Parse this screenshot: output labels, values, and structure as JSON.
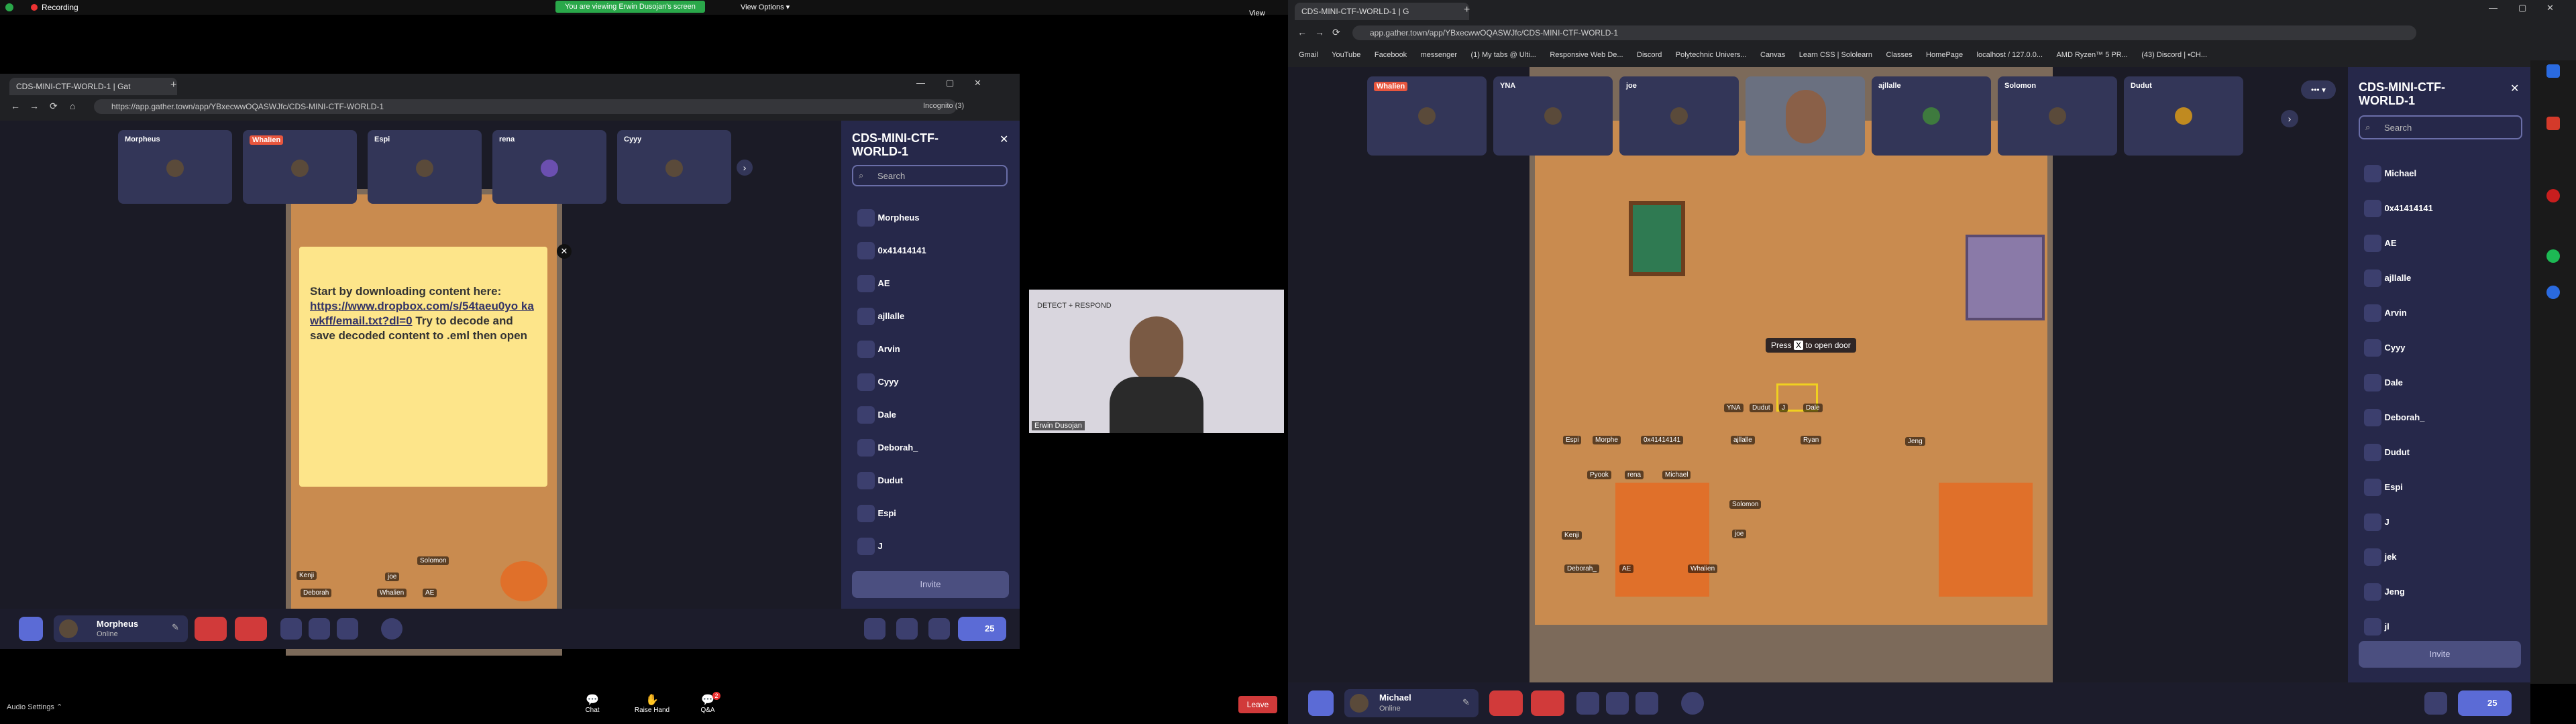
{
  "zoom": {
    "recording_label": "Recording",
    "viewing_banner": "You are viewing Erwin Dusojan's screen",
    "view_options": "View Options ▾",
    "view_label": "View",
    "audio_settings": "Audio Settings ⌃",
    "chat_label": "Chat",
    "raise_hand_label": "Raise Hand",
    "qa_label": "Q&A",
    "qa_badge": "2",
    "leave_label": "Leave",
    "webcam_overlay": "DETECT + RESPOND",
    "webcam_name": "Erwin Dusojan"
  },
  "left_browser": {
    "tab_title": "CDS-MINI-CTF-WORLD-1 | Gat",
    "url": "https://app.gather.town/app/YBxecwwOQASWJfc/CDS-MINI-CTF-WORLD-1",
    "incognito": "Incognito (3)",
    "participants": [
      {
        "name": "Morpheus"
      },
      {
        "name": "Whalien"
      },
      {
        "name": "Espi"
      },
      {
        "name": "rena"
      },
      {
        "name": "Cyyy"
      }
    ],
    "note_text_1": "Start by downloading content here:",
    "note_link": "https://www.dropbox.com/s/54taeu0yo kawkff/email.txt?dl=0",
    "note_text_2": "Try to decode and save decoded content to .eml then open",
    "map_tags": [
      "Kenji",
      "Deborah",
      "Whalien",
      "AE",
      "joe",
      "Solomon"
    ],
    "panel_title": "CDS-MINI-CTF-WORLD-1",
    "search_placeholder": "Search",
    "members": [
      "Morpheus",
      "0x41414141",
      "AE",
      "ajllalle",
      "Arvin",
      "Cyyy",
      "Dale",
      "Deborah_",
      "Dudut",
      "Espi",
      "J"
    ],
    "invite_label": "Invite",
    "me_name": "Morpheus",
    "me_status": "Online",
    "people_count": "25"
  },
  "right_browser": {
    "tab_title": "CDS-MINI-CTF-WORLD-1 | G",
    "url": "app.gather.town/app/YBxecwwOQASWJfc/CDS-MINI-CTF-WORLD-1",
    "bookmarks": [
      "Gmail",
      "YouTube",
      "Facebook",
      "messenger",
      "(1) My tabs @ Ulti...",
      "Responsive Web De...",
      "Discord",
      "Polytechnic Univers...",
      "Canvas",
      "Learn CSS | Sololearn",
      "Classes",
      "HomePage",
      "localhost / 127.0.0...",
      "AMD Ryzen™ 5 PR...",
      "(43) Discord | •CH..."
    ],
    "participants": [
      {
        "name": "Whalien"
      },
      {
        "name": "YNA"
      },
      {
        "name": "joe"
      },
      {
        "name": ""
      },
      {
        "name": "ajllalle"
      },
      {
        "name": "Solomon"
      },
      {
        "name": "Dudut"
      }
    ],
    "door_prompt_1": "Press",
    "door_prompt_key": "X",
    "door_prompt_2": "to open door",
    "map_tags": [
      "YNA",
      "Dudut",
      "J",
      "Dale",
      "Espi",
      "Morphe",
      "0x41414141",
      "ajllalle",
      "Ryan",
      "Jeng",
      "Pyook",
      "rena",
      "Michael",
      "Solomon",
      "joe",
      "Kenji",
      "Deborah_",
      "AE",
      "Whalien"
    ],
    "panel_title": "CDS-MINI-CTF-WORLD-1",
    "search_placeholder": "Search",
    "members": [
      "Michael",
      "0x41414141",
      "AE",
      "ajllalle",
      "Arvin",
      "Cyyy",
      "Dale",
      "Deborah_",
      "Dudut",
      "Espi",
      "J",
      "jek",
      "Jeng",
      "jl"
    ],
    "invite_label": "Invite",
    "me_name": "Michael",
    "me_status": "Online",
    "people_count": "25"
  }
}
